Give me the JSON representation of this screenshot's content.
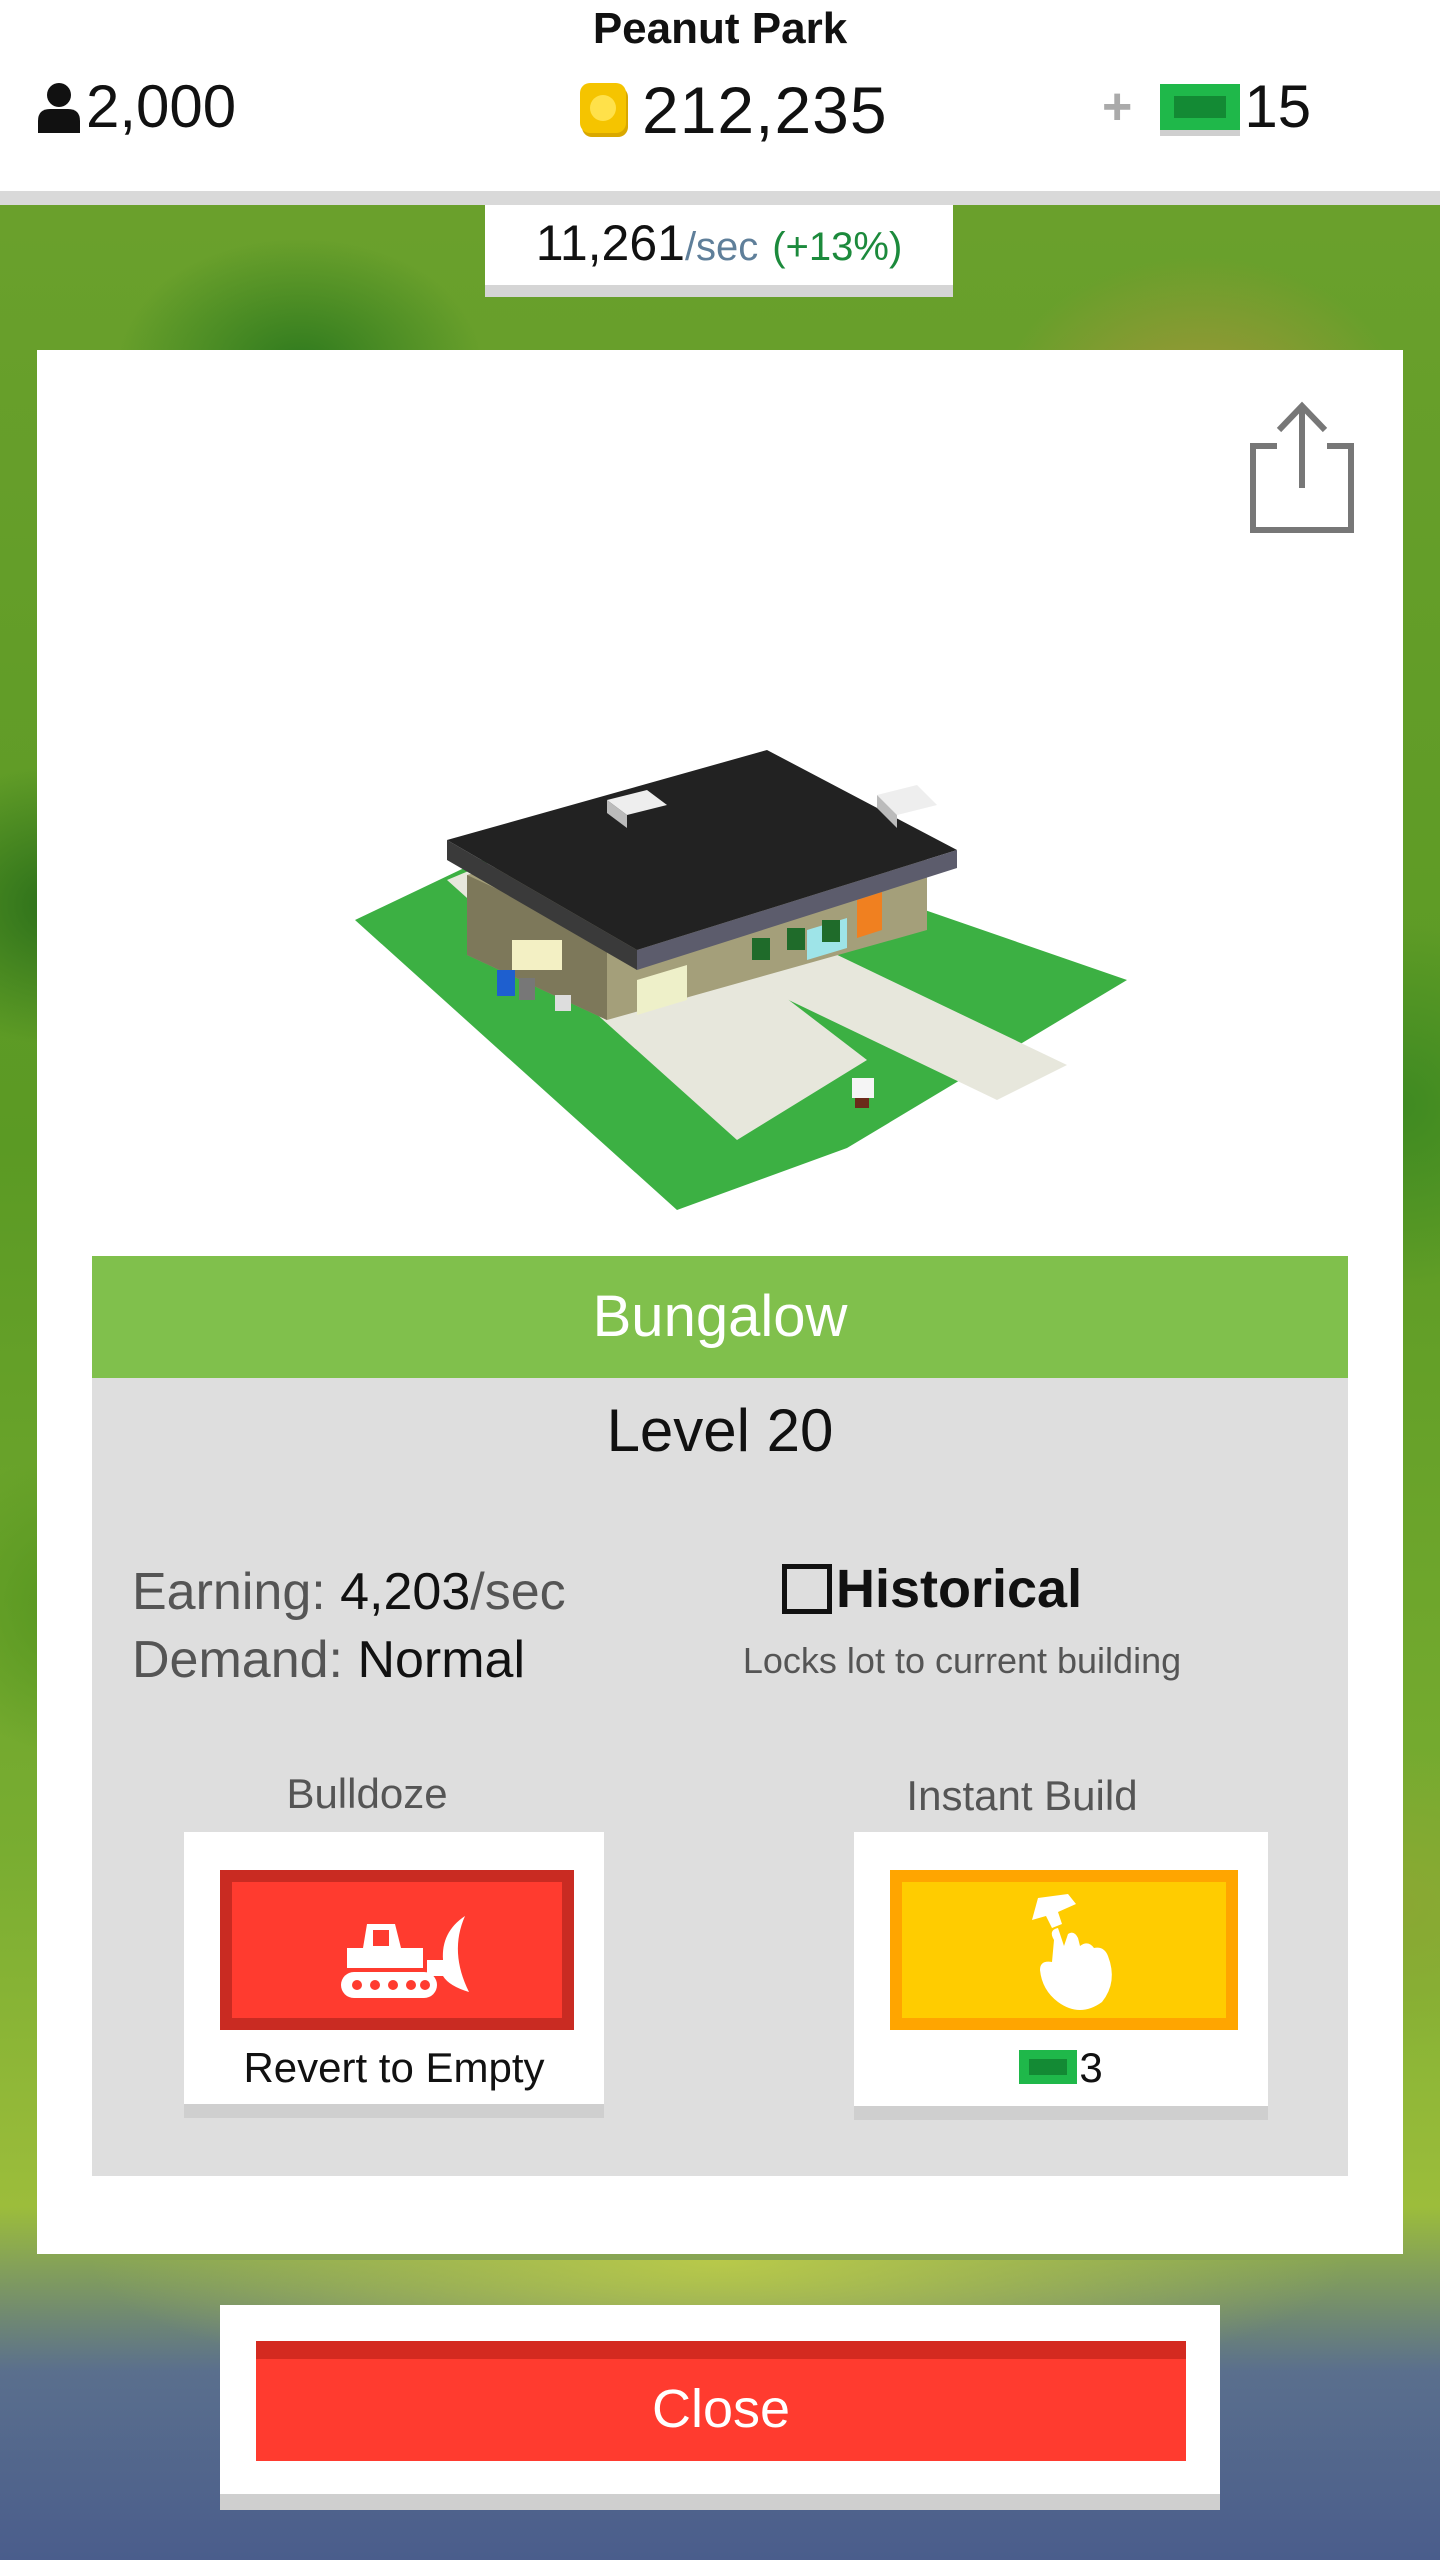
{
  "hud": {
    "park_name": "Peanut Park",
    "population": "2,000",
    "coins": "212,235",
    "plus": "+",
    "cash": "15",
    "icons": {
      "population": "person-icon",
      "coins": "coin-icon",
      "cash": "cash-bill-icon"
    }
  },
  "rate": {
    "value": "11,261",
    "unit": "/sec",
    "pct": "(+13%)"
  },
  "building": {
    "name": "Bungalow",
    "level": "Level 20",
    "earning_label": "Earning:",
    "earning_value": "4,203",
    "earning_unit": "/sec",
    "demand_label": "Demand:",
    "demand_value": "Normal"
  },
  "historical": {
    "label": "Historical",
    "checked": false,
    "subtitle": "Locks lot to current building"
  },
  "bulldoze": {
    "title": "Bulldoze",
    "caption": "Revert to Empty",
    "icon": "bulldozer-icon"
  },
  "instant_build": {
    "title": "Instant Build",
    "cost": "3",
    "icon": "hammer-hand-icon"
  },
  "close": {
    "label": "Close"
  },
  "colors": {
    "accent_green": "#80c04c",
    "red_button": "#ff3b2f",
    "yellow_button": "#ffcc00",
    "cash_green": "#22c55e",
    "coin_gold": "#f5c400"
  }
}
